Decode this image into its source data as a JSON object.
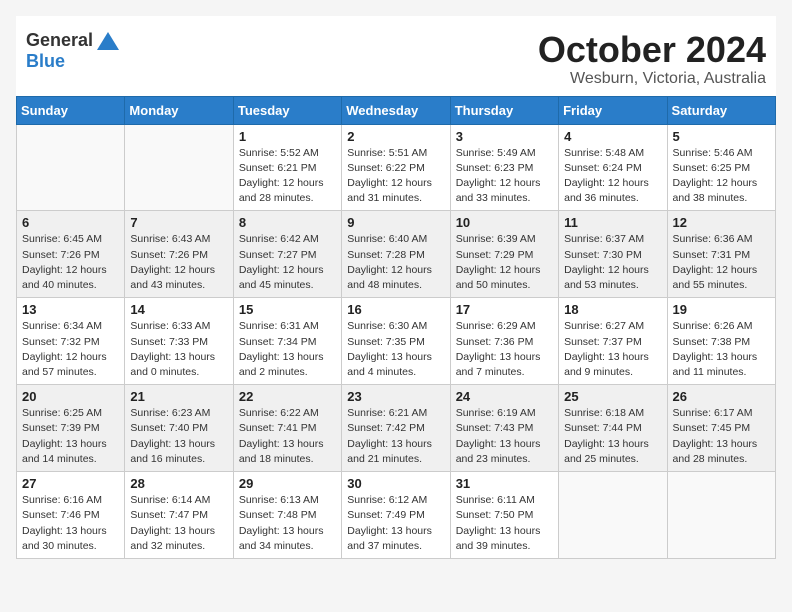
{
  "header": {
    "logo_general": "General",
    "logo_blue": "Blue",
    "title": "October 2024",
    "location": "Wesburn, Victoria, Australia"
  },
  "weekdays": [
    "Sunday",
    "Monday",
    "Tuesday",
    "Wednesday",
    "Thursday",
    "Friday",
    "Saturday"
  ],
  "weeks": [
    [
      {
        "day": "",
        "empty": true
      },
      {
        "day": "",
        "empty": true
      },
      {
        "day": "1",
        "sunrise": "Sunrise: 5:52 AM",
        "sunset": "Sunset: 6:21 PM",
        "daylight": "Daylight: 12 hours and 28 minutes."
      },
      {
        "day": "2",
        "sunrise": "Sunrise: 5:51 AM",
        "sunset": "Sunset: 6:22 PM",
        "daylight": "Daylight: 12 hours and 31 minutes."
      },
      {
        "day": "3",
        "sunrise": "Sunrise: 5:49 AM",
        "sunset": "Sunset: 6:23 PM",
        "daylight": "Daylight: 12 hours and 33 minutes."
      },
      {
        "day": "4",
        "sunrise": "Sunrise: 5:48 AM",
        "sunset": "Sunset: 6:24 PM",
        "daylight": "Daylight: 12 hours and 36 minutes."
      },
      {
        "day": "5",
        "sunrise": "Sunrise: 5:46 AM",
        "sunset": "Sunset: 6:25 PM",
        "daylight": "Daylight: 12 hours and 38 minutes."
      }
    ],
    [
      {
        "day": "6",
        "sunrise": "Sunrise: 6:45 AM",
        "sunset": "Sunset: 7:26 PM",
        "daylight": "Daylight: 12 hours and 40 minutes."
      },
      {
        "day": "7",
        "sunrise": "Sunrise: 6:43 AM",
        "sunset": "Sunset: 7:26 PM",
        "daylight": "Daylight: 12 hours and 43 minutes."
      },
      {
        "day": "8",
        "sunrise": "Sunrise: 6:42 AM",
        "sunset": "Sunset: 7:27 PM",
        "daylight": "Daylight: 12 hours and 45 minutes."
      },
      {
        "day": "9",
        "sunrise": "Sunrise: 6:40 AM",
        "sunset": "Sunset: 7:28 PM",
        "daylight": "Daylight: 12 hours and 48 minutes."
      },
      {
        "day": "10",
        "sunrise": "Sunrise: 6:39 AM",
        "sunset": "Sunset: 7:29 PM",
        "daylight": "Daylight: 12 hours and 50 minutes."
      },
      {
        "day": "11",
        "sunrise": "Sunrise: 6:37 AM",
        "sunset": "Sunset: 7:30 PM",
        "daylight": "Daylight: 12 hours and 53 minutes."
      },
      {
        "day": "12",
        "sunrise": "Sunrise: 6:36 AM",
        "sunset": "Sunset: 7:31 PM",
        "daylight": "Daylight: 12 hours and 55 minutes."
      }
    ],
    [
      {
        "day": "13",
        "sunrise": "Sunrise: 6:34 AM",
        "sunset": "Sunset: 7:32 PM",
        "daylight": "Daylight: 12 hours and 57 minutes."
      },
      {
        "day": "14",
        "sunrise": "Sunrise: 6:33 AM",
        "sunset": "Sunset: 7:33 PM",
        "daylight": "Daylight: 13 hours and 0 minutes."
      },
      {
        "day": "15",
        "sunrise": "Sunrise: 6:31 AM",
        "sunset": "Sunset: 7:34 PM",
        "daylight": "Daylight: 13 hours and 2 minutes."
      },
      {
        "day": "16",
        "sunrise": "Sunrise: 6:30 AM",
        "sunset": "Sunset: 7:35 PM",
        "daylight": "Daylight: 13 hours and 4 minutes."
      },
      {
        "day": "17",
        "sunrise": "Sunrise: 6:29 AM",
        "sunset": "Sunset: 7:36 PM",
        "daylight": "Daylight: 13 hours and 7 minutes."
      },
      {
        "day": "18",
        "sunrise": "Sunrise: 6:27 AM",
        "sunset": "Sunset: 7:37 PM",
        "daylight": "Daylight: 13 hours and 9 minutes."
      },
      {
        "day": "19",
        "sunrise": "Sunrise: 6:26 AM",
        "sunset": "Sunset: 7:38 PM",
        "daylight": "Daylight: 13 hours and 11 minutes."
      }
    ],
    [
      {
        "day": "20",
        "sunrise": "Sunrise: 6:25 AM",
        "sunset": "Sunset: 7:39 PM",
        "daylight": "Daylight: 13 hours and 14 minutes."
      },
      {
        "day": "21",
        "sunrise": "Sunrise: 6:23 AM",
        "sunset": "Sunset: 7:40 PM",
        "daylight": "Daylight: 13 hours and 16 minutes."
      },
      {
        "day": "22",
        "sunrise": "Sunrise: 6:22 AM",
        "sunset": "Sunset: 7:41 PM",
        "daylight": "Daylight: 13 hours and 18 minutes."
      },
      {
        "day": "23",
        "sunrise": "Sunrise: 6:21 AM",
        "sunset": "Sunset: 7:42 PM",
        "daylight": "Daylight: 13 hours and 21 minutes."
      },
      {
        "day": "24",
        "sunrise": "Sunrise: 6:19 AM",
        "sunset": "Sunset: 7:43 PM",
        "daylight": "Daylight: 13 hours and 23 minutes."
      },
      {
        "day": "25",
        "sunrise": "Sunrise: 6:18 AM",
        "sunset": "Sunset: 7:44 PM",
        "daylight": "Daylight: 13 hours and 25 minutes."
      },
      {
        "day": "26",
        "sunrise": "Sunrise: 6:17 AM",
        "sunset": "Sunset: 7:45 PM",
        "daylight": "Daylight: 13 hours and 28 minutes."
      }
    ],
    [
      {
        "day": "27",
        "sunrise": "Sunrise: 6:16 AM",
        "sunset": "Sunset: 7:46 PM",
        "daylight": "Daylight: 13 hours and 30 minutes."
      },
      {
        "day": "28",
        "sunrise": "Sunrise: 6:14 AM",
        "sunset": "Sunset: 7:47 PM",
        "daylight": "Daylight: 13 hours and 32 minutes."
      },
      {
        "day": "29",
        "sunrise": "Sunrise: 6:13 AM",
        "sunset": "Sunset: 7:48 PM",
        "daylight": "Daylight: 13 hours and 34 minutes."
      },
      {
        "day": "30",
        "sunrise": "Sunrise: 6:12 AM",
        "sunset": "Sunset: 7:49 PM",
        "daylight": "Daylight: 13 hours and 37 minutes."
      },
      {
        "day": "31",
        "sunrise": "Sunrise: 6:11 AM",
        "sunset": "Sunset: 7:50 PM",
        "daylight": "Daylight: 13 hours and 39 minutes."
      },
      {
        "day": "",
        "empty": true
      },
      {
        "day": "",
        "empty": true
      }
    ]
  ]
}
